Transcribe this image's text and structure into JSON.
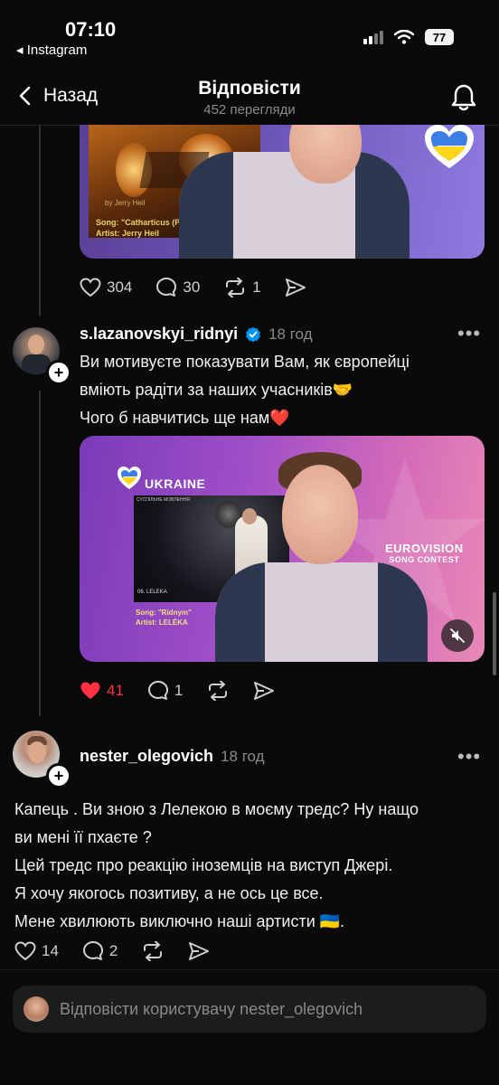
{
  "status_bar": {
    "time": "07:10",
    "back_app": "◂ Instagram",
    "battery": "77"
  },
  "header": {
    "back_label": "Назад",
    "title": "Відповісти",
    "views": "452 перегляди"
  },
  "post1": {
    "media": {
      "song": "Song: \"Catharticus (P",
      "artist": "Artist: Jerry Heil",
      "credit": "by Jerry Heil"
    },
    "likes": "304",
    "comments": "30",
    "reposts": "1"
  },
  "post2": {
    "username": "s.lazanovskyi_ridnyi",
    "time": "18 год",
    "lines": [
      "Ви мотивуєте показувати Вам, як європейці",
      "вміють радіти за наших учасників🤝",
      "Чого б навчитись ще нам❤️"
    ],
    "media": {
      "country": "UKRAINE",
      "song": "Song: \"Ridnym\"",
      "artist": "Artist: LELĖKA",
      "eurovision": "EUROVISION",
      "contest": "SONG CONTEST",
      "broadcaster": "СУСПІЛЬНЕ МОВЛЕННЯ",
      "running_order": "06. LELEKA"
    },
    "likes": "41",
    "comments": "1"
  },
  "post3": {
    "username": "nester_olegovich",
    "time": "18 год",
    "lines": [
      "Капець . Ви зною з Лелекою в моєму тредс? Ну нащо",
      "ви мені її пхаєте ?",
      "Цей тредс про реакцію іноземців на виступ Джері.",
      "Я хочу якогось позитиву, а не ось це все.",
      "Мене хвилюють виключно наші артисти 🇺🇦."
    ],
    "likes": "14",
    "comments": "2"
  },
  "reply": {
    "placeholder": "Відповісти користувачу nester_olegovich"
  },
  "colors": {
    "like_active": "#ff3040",
    "background": "#0a0a0a",
    "muted": "#8a8a8a",
    "verified": "#0095f6"
  }
}
